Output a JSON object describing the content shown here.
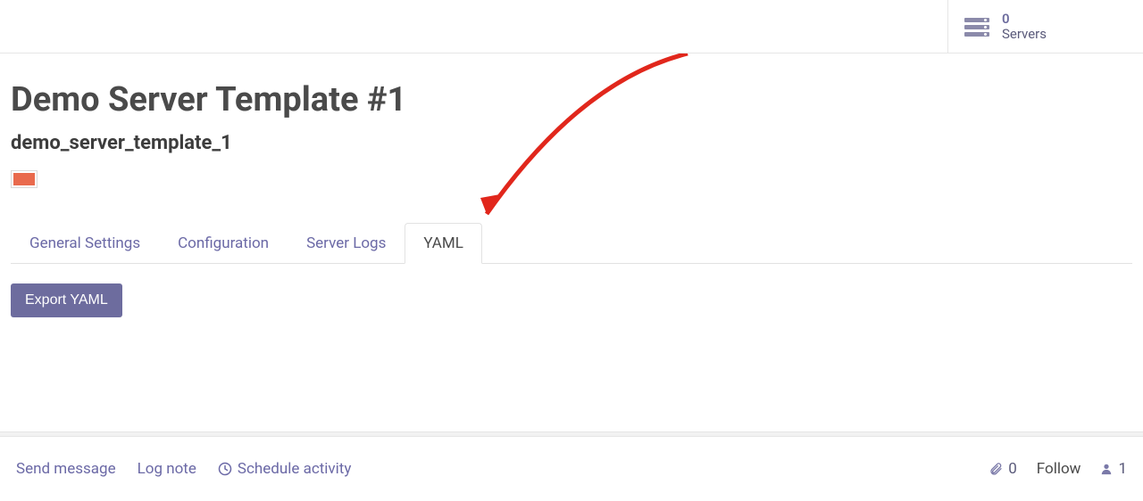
{
  "stat": {
    "count": "0",
    "label": "Servers"
  },
  "header": {
    "title": "Demo Server Template #1",
    "subtitle": "demo_server_template_1",
    "color": "#e96a4d"
  },
  "tabs": [
    {
      "label": "General Settings",
      "active": false
    },
    {
      "label": "Configuration",
      "active": false
    },
    {
      "label": "Server Logs",
      "active": false
    },
    {
      "label": "YAML",
      "active": true
    }
  ],
  "actions": {
    "export_yaml": "Export YAML"
  },
  "bottom": {
    "send_message": "Send message",
    "log_note": "Log note",
    "schedule_activity": "Schedule activity",
    "attachment_count": "0",
    "follow": "Follow",
    "follower_count": "1"
  }
}
